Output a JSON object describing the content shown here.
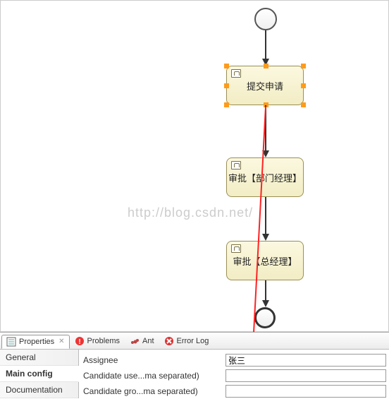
{
  "diagram": {
    "start": "start-event",
    "end": "end-event",
    "tasks": [
      {
        "label": "提交申请"
      },
      {
        "label": "审批【部门经理】"
      },
      {
        "label": "审批【总经理】"
      }
    ]
  },
  "watermark": "http://blog.csdn.net/",
  "tabs": {
    "items": [
      {
        "label": "Properties"
      },
      {
        "label": "Problems"
      },
      {
        "label": "Ant"
      },
      {
        "label": "Error Log"
      }
    ],
    "close_char": "✕"
  },
  "side_tabs": {
    "items": [
      {
        "label": "General"
      },
      {
        "label": "Main config"
      },
      {
        "label": "Documentation"
      }
    ]
  },
  "form": {
    "assignee_label": "Assignee",
    "assignee_value": "张三",
    "candidate_users_label": "Candidate use...ma separated)",
    "candidate_users_value": "",
    "candidate_groups_label": "Candidate gro...ma separated)",
    "candidate_groups_value": ""
  }
}
